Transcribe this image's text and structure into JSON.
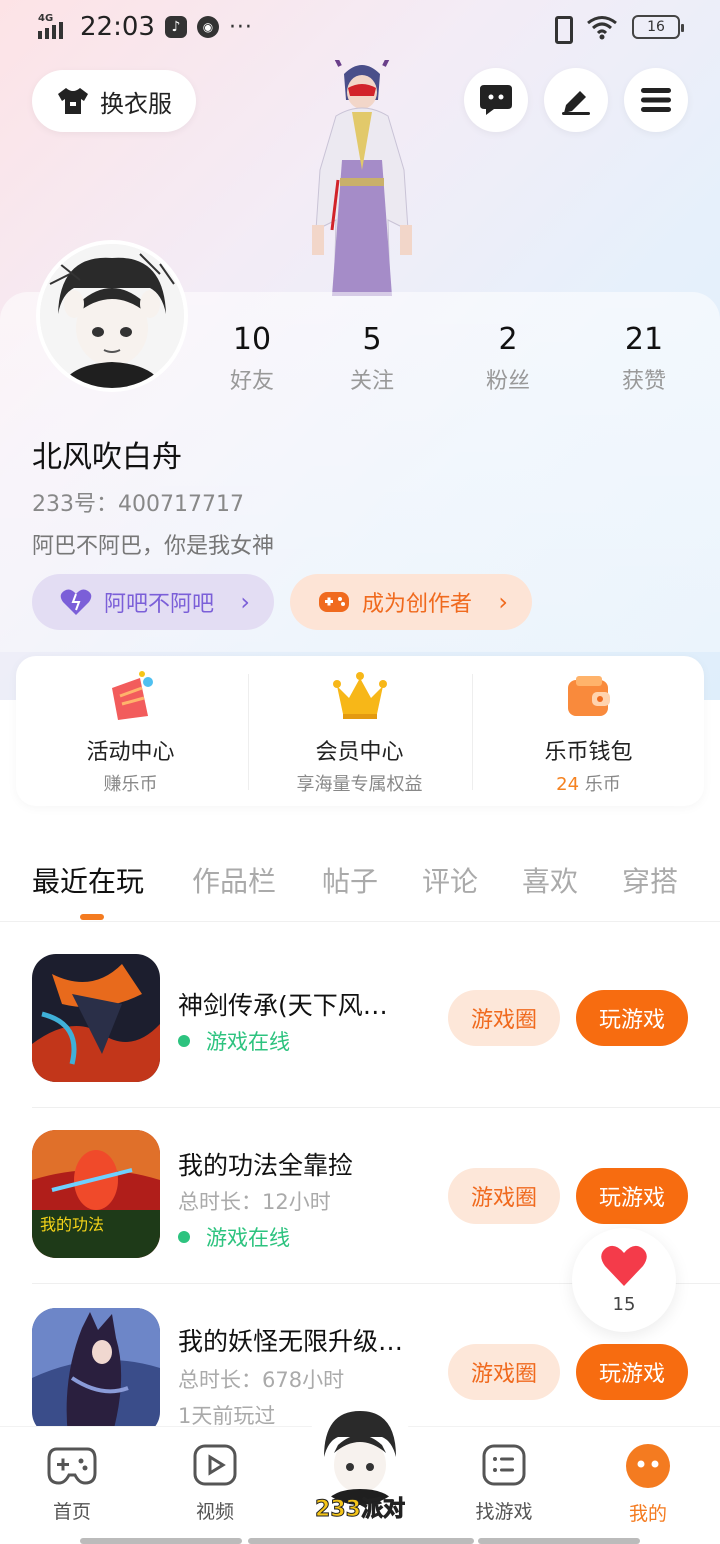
{
  "status_bar": {
    "network": "4G",
    "time": "22:03",
    "battery": "16"
  },
  "header": {
    "wardrobe_label": "换衣服"
  },
  "profile": {
    "stats": [
      {
        "value": "10",
        "label": "好友"
      },
      {
        "value": "5",
        "label": "关注"
      },
      {
        "value": "2",
        "label": "粉丝"
      },
      {
        "value": "21",
        "label": "获赞"
      }
    ],
    "nickname": "北风吹白舟",
    "uid": "233号：400717717",
    "bio": "阿巴不阿巴，你是我女神",
    "tag_pill": "阿吧不阿吧",
    "creator_pill": "成为创作者"
  },
  "quick_entries": [
    {
      "title": "活动中心",
      "sub": "赚乐币",
      "icon": "activity-icon"
    },
    {
      "title": "会员中心",
      "sub": "享海量专属权益",
      "icon": "crown-icon"
    },
    {
      "title": "乐币钱包",
      "sub_value": "24",
      "sub_unit": " 乐币",
      "icon": "wallet-icon"
    }
  ],
  "tabs": [
    "最近在玩",
    "作品栏",
    "帖子",
    "评论",
    "喜欢",
    "穿搭"
  ],
  "games": [
    {
      "name": "神剑传承(天下风…",
      "online": "游戏在线",
      "circle_btn": "游戏圈",
      "play_btn": "玩游戏"
    },
    {
      "name": "我的功法全靠捡",
      "playtime": "总时长：12小时",
      "online": "游戏在线",
      "circle_btn": "游戏圈",
      "play_btn": "玩游戏"
    },
    {
      "name": "我的妖怪无限升级…",
      "playtime": "总时长：678小时",
      "last_played": "1天前玩过",
      "circle_btn": "游戏圈",
      "play_btn": "玩游戏"
    }
  ],
  "like_bubble": {
    "count": "15"
  },
  "bottom_nav": [
    {
      "label": "首页",
      "icon": "gamepad-icon"
    },
    {
      "label": "视频",
      "icon": "video-icon"
    },
    {
      "label": "233派对",
      "icon": "party-avatar"
    },
    {
      "label": "找游戏",
      "icon": "find-game-icon"
    },
    {
      "label": "我的",
      "icon": "me-icon"
    }
  ],
  "colors": {
    "accent_orange": "#f76c10",
    "online_green": "#2dc37f",
    "purple": "#7b5fd8"
  }
}
